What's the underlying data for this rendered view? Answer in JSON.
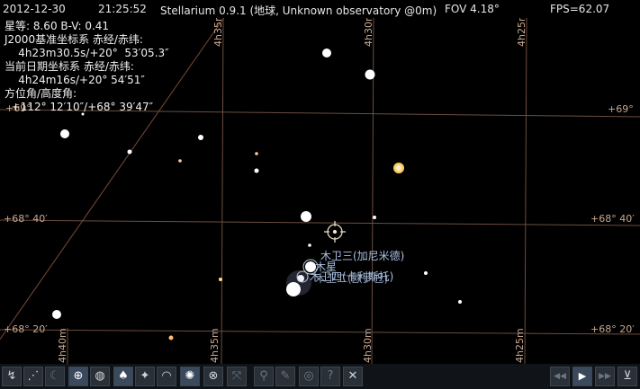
{
  "topbar": {
    "date": "2012-12-30",
    "time": "21:25:52",
    "app": "Stellarium 0.9.1 (地球, Unknown observatory @0m)",
    "fov": "FOV 4.18°",
    "fps": "FPS=62.07"
  },
  "object_info": {
    "magnitude": "星等: 8.60 B-V: 0.41",
    "j2000_label": "J2000基准坐标系 赤经/赤纬:",
    "j2000_value": "    4h23m30.5s/+20°  53′05.3″",
    "date_label": "当前日期坐标系 赤经/赤纬:",
    "date_value": "    4h24m16s/+20° 54′51″",
    "azalt_label": "方位角/高度角:",
    "azalt_value": "  +112° 12′10″/+68° 39′47″"
  },
  "grid_labels": {
    "alt_69_left": "+69°",
    "alt_69_right": "+69°",
    "alt_6840_left": "+68° 40′",
    "alt_6840_right": "+68° 40′",
    "alt_6820_left": "+68° 20′",
    "alt_6820_right": "+68° 20′",
    "ra_4h35m_top": "4h35m",
    "ra_4h30m_top": "4h30m",
    "ra_4h25m_top": "4h25m",
    "ra_4h40m_bottom": "4h40m",
    "ra_4h35m_bottom": "4h35m",
    "ra_4h30m_bottom": "4h30m",
    "ra_4h25m_bottom": "4h25m"
  },
  "labels": {
    "ganymede": "木卫三(加尼米德)",
    "jupiter": "木星",
    "callisto_europa": "木卫四(卡利斯托)",
    "europa": "木卫二(欧罗巴)"
  },
  "toolbar": {
    "left": [
      {
        "name": "constellation-lines-icon",
        "glyph": "↯"
      },
      {
        "name": "constellation-names-icon",
        "glyph": "⋰"
      },
      {
        "name": "constellation-art-icon",
        "glyph": "☾"
      },
      {
        "name": "equatorial-grid-icon",
        "glyph": "⊕"
      },
      {
        "name": "azimuth-grid-icon",
        "glyph": "◍"
      },
      {
        "name": "ground-icon",
        "glyph": "♠"
      },
      {
        "name": "cardinal-points-icon",
        "glyph": "✦"
      },
      {
        "name": "atmosphere-icon",
        "glyph": "◠"
      },
      {
        "name": "nebulas-icon",
        "glyph": "✺"
      },
      {
        "name": "equatorial-mount-icon",
        "glyph": "⊗"
      },
      {
        "name": "fullscreen-icon",
        "glyph": "⤧"
      },
      {
        "name": "search-icon",
        "glyph": "⚲"
      },
      {
        "name": "config-icon",
        "glyph": "✎"
      },
      {
        "name": "view-icon",
        "glyph": "◎"
      },
      {
        "name": "help-icon",
        "glyph": "?"
      },
      {
        "name": "quit-icon",
        "glyph": "✕"
      }
    ],
    "right": [
      {
        "name": "rewind-icon",
        "glyph": "◀◀"
      },
      {
        "name": "play-icon",
        "glyph": "▶"
      },
      {
        "name": "forward-icon",
        "glyph": "▶▶"
      },
      {
        "name": "now-icon",
        "glyph": "⊻"
      }
    ]
  },
  "colors": {
    "grid": "#7a5a48",
    "info_text": "#f0f0f0",
    "label": "#a8c0e0",
    "toolbar_bg": "#101418"
  }
}
